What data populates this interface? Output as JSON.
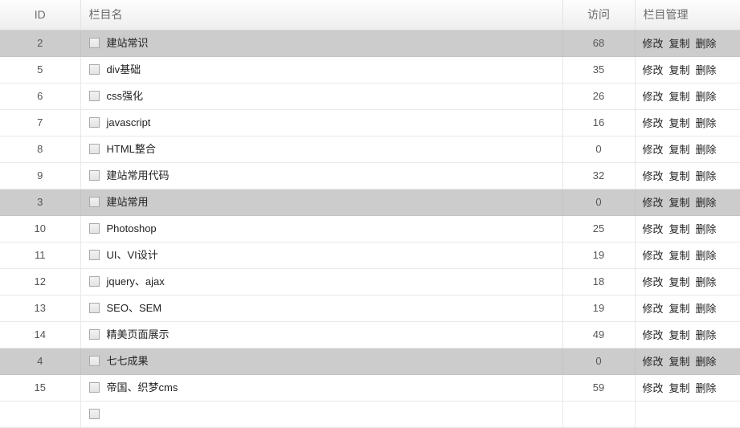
{
  "table": {
    "columns": [
      {
        "key": "id",
        "label": "ID"
      },
      {
        "key": "name",
        "label": "栏目名"
      },
      {
        "key": "visits",
        "label": "访问"
      },
      {
        "key": "manage",
        "label": "栏目管理"
      }
    ],
    "manage_actions": {
      "edit": "修改",
      "copy": "复制",
      "delete": "删除"
    },
    "rows": [
      {
        "id": "2",
        "name": "建站常识",
        "visits": "68",
        "highlight": true
      },
      {
        "id": "5",
        "name": "div基础",
        "visits": "35",
        "highlight": false
      },
      {
        "id": "6",
        "name": "css强化",
        "visits": "26",
        "highlight": false
      },
      {
        "id": "7",
        "name": "javascript",
        "visits": "16",
        "highlight": false
      },
      {
        "id": "8",
        "name": "HTML整合",
        "visits": "0",
        "highlight": false
      },
      {
        "id": "9",
        "name": "建站常用代码",
        "visits": "32",
        "highlight": false
      },
      {
        "id": "3",
        "name": "建站常用",
        "visits": "0",
        "highlight": true
      },
      {
        "id": "10",
        "name": "Photoshop",
        "visits": "25",
        "highlight": false
      },
      {
        "id": "11",
        "name": "UI、VI设计",
        "visits": "19",
        "highlight": false
      },
      {
        "id": "12",
        "name": "jquery、ajax",
        "visits": "18",
        "highlight": false
      },
      {
        "id": "13",
        "name": "SEO、SEM",
        "visits": "19",
        "highlight": false
      },
      {
        "id": "14",
        "name": "精美页面展示",
        "visits": "49",
        "highlight": false
      },
      {
        "id": "4",
        "name": "七七成果",
        "visits": "0",
        "highlight": true
      },
      {
        "id": "15",
        "name": "帝国、织梦cms",
        "visits": "59",
        "highlight": false
      },
      {
        "id": "",
        "name": "",
        "visits": "",
        "highlight": false
      }
    ]
  },
  "colors": {
    "header_text": "#6b6b6b",
    "row_highlight": "#cccccc",
    "row_border": "#e8e8e8",
    "body_text": "#222222"
  }
}
